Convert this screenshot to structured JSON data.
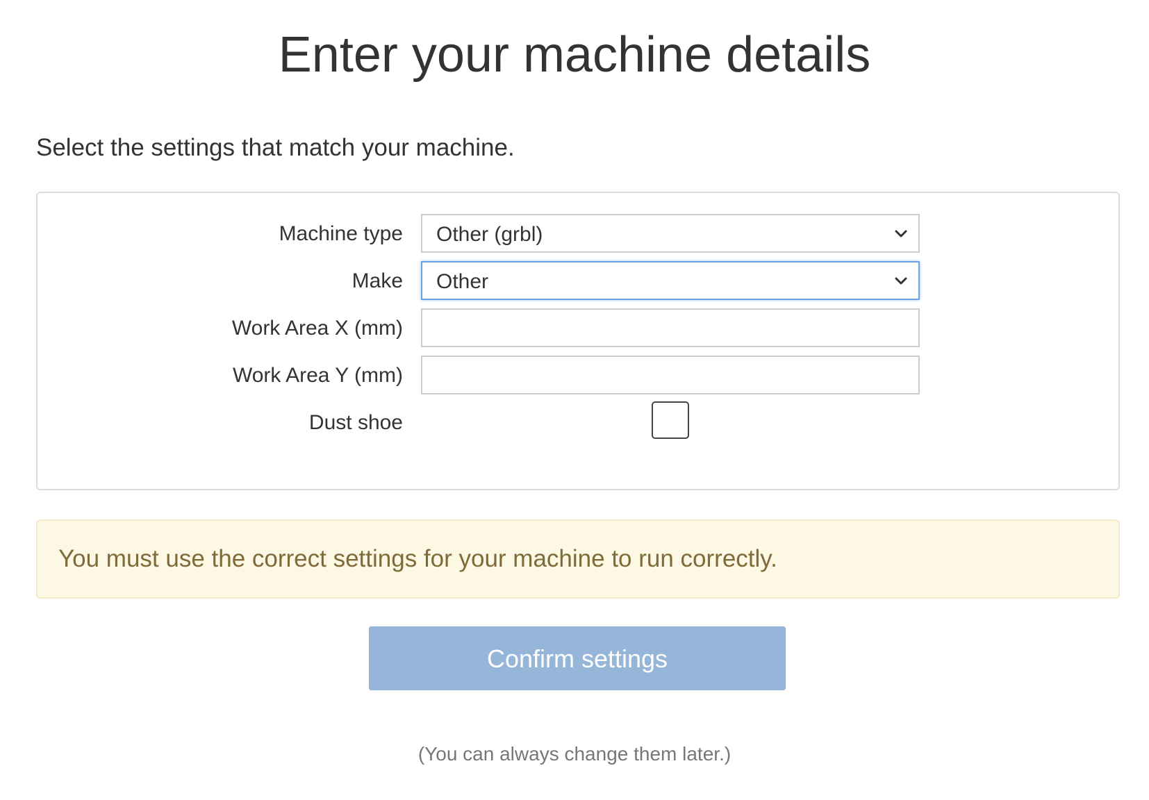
{
  "header": {
    "title": "Enter your machine details",
    "subtitle": "Select the settings that match your machine."
  },
  "form": {
    "machine_type": {
      "label": "Machine type",
      "value": "Other (grbl)"
    },
    "make": {
      "label": "Make",
      "value": "Other"
    },
    "work_area_x": {
      "label": "Work Area X (mm)",
      "value": ""
    },
    "work_area_y": {
      "label": "Work Area Y (mm)",
      "value": ""
    },
    "dust_shoe": {
      "label": "Dust shoe",
      "checked": false
    }
  },
  "warning": {
    "text": "You must use the correct settings for your machine to run correctly."
  },
  "actions": {
    "confirm_label": "Confirm settings",
    "confirm_enabled": false
  },
  "footer": {
    "note": "(You can always change them later.)"
  },
  "colors": {
    "button_bg": "#95b5d9",
    "warning_bg": "#fcf8e3",
    "warning_text": "#7f6a3a",
    "focus_border": "#66a3e0"
  }
}
